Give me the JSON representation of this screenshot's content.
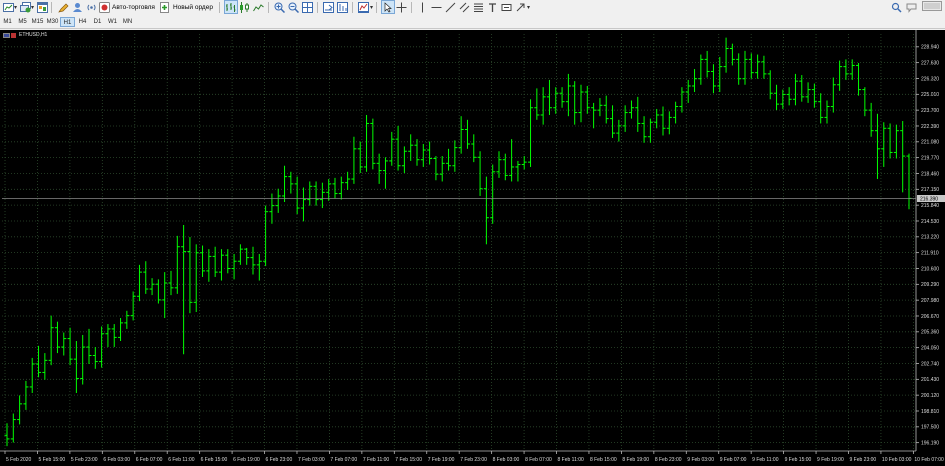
{
  "toolbar": {
    "autotrading_label": "Авто-торговля",
    "new_order_label": "Новый ордер"
  },
  "timeframes": [
    {
      "label": "M1",
      "active": false
    },
    {
      "label": "M5",
      "active": false
    },
    {
      "label": "M15",
      "active": false
    },
    {
      "label": "M30",
      "active": false
    },
    {
      "label": "H1",
      "active": true
    },
    {
      "label": "H4",
      "active": false
    },
    {
      "label": "D1",
      "active": false
    },
    {
      "label": "W1",
      "active": false
    },
    {
      "label": "MN",
      "active": false
    }
  ],
  "chart": {
    "symbol_label": "ETHUSD,H1",
    "current_price": "216.390",
    "price_ticks": [
      "228.940",
      "227.630",
      "226.320",
      "225.010",
      "223.700",
      "222.390",
      "221.080",
      "219.770",
      "218.460",
      "217.150",
      "215.840",
      "214.530",
      "213.220",
      "211.910",
      "210.600",
      "209.290",
      "207.980",
      "206.670",
      "205.360",
      "204.050",
      "202.740",
      "201.430",
      "200.120",
      "198.810",
      "197.500",
      "196.190"
    ],
    "time_ticks": [
      "5 Feb 2020",
      "5 Feb 15:00",
      "5 Feb 23:00",
      "6 Feb 03:00",
      "6 Feb 07:00",
      "6 Feb 11:00",
      "6 Feb 15:00",
      "6 Feb 19:00",
      "6 Feb 23:00",
      "7 Feb 03:00",
      "7 Feb 07:00",
      "7 Feb 11:00",
      "7 Feb 15:00",
      "7 Feb 19:00",
      "7 Feb 23:00",
      "8 Feb 03:00",
      "8 Feb 07:00",
      "8 Feb 11:00",
      "8 Feb 15:00",
      "8 Feb 19:00",
      "8 Feb 23:00",
      "9 Feb 03:00",
      "9 Feb 07:00",
      "9 Feb 11:00",
      "9 Feb 15:00",
      "9 Feb 19:00",
      "9 Feb 23:00",
      "10 Feb 03:00",
      "10 Feb 07:00"
    ],
    "bar_color": "#00ff00",
    "grid_color": "#2e4a2e"
  },
  "chart_data": {
    "type": "ohlc",
    "price_range": [
      195.5,
      230.0
    ],
    "series": [
      {
        "values": [
          [
            196.8,
            197.8,
            195.9,
            196.5
          ],
          [
            196.5,
            198.6,
            196.2,
            198.1
          ],
          [
            198.1,
            200.1,
            197.7,
            199.4
          ],
          [
            199.4,
            201.3,
            198.9,
            200.8
          ],
          [
            200.8,
            203.2,
            200.3,
            202.7
          ],
          [
            202.7,
            204.2,
            201.6,
            202.0
          ],
          [
            202.0,
            203.6,
            201.4,
            203.0
          ],
          [
            203.0,
            206.7,
            202.6,
            205.7
          ],
          [
            205.7,
            206.2,
            203.6,
            204.1
          ],
          [
            204.1,
            205.3,
            203.4,
            204.8
          ],
          [
            204.8,
            205.7,
            202.6,
            203.1
          ],
          [
            203.1,
            204.6,
            200.3,
            201.5
          ],
          [
            201.5,
            205.1,
            201.0,
            204.1
          ],
          [
            204.1,
            205.6,
            202.7,
            203.4
          ],
          [
            203.4,
            204.1,
            202.3,
            202.9
          ],
          [
            202.9,
            205.8,
            202.4,
            205.2
          ],
          [
            205.2,
            206.0,
            204.1,
            205.6
          ],
          [
            205.6,
            206.0,
            204.1,
            204.9
          ],
          [
            204.9,
            206.5,
            204.6,
            206.1
          ],
          [
            206.1,
            207.1,
            205.6,
            206.7
          ],
          [
            206.7,
            208.7,
            206.3,
            208.3
          ],
          [
            208.3,
            210.9,
            207.9,
            210.3
          ],
          [
            210.3,
            211.2,
            208.5,
            208.9
          ],
          [
            208.9,
            209.8,
            208.4,
            209.3
          ],
          [
            209.3,
            209.7,
            207.7,
            208.0
          ],
          [
            208.0,
            210.3,
            206.5,
            209.4
          ],
          [
            209.4,
            210.4,
            208.4,
            209.0
          ],
          [
            209.0,
            213.3,
            208.5,
            212.4
          ],
          [
            212.4,
            214.2,
            203.5,
            212.0
          ],
          [
            212.0,
            213.2,
            206.9,
            207.8
          ],
          [
            207.8,
            212.6,
            207.0,
            211.9
          ],
          [
            211.9,
            212.5,
            209.9,
            210.4
          ],
          [
            210.4,
            212.2,
            209.5,
            211.6
          ],
          [
            211.6,
            212.4,
            209.9,
            210.3
          ],
          [
            210.3,
            212.2,
            209.6,
            211.7
          ],
          [
            211.7,
            212.2,
            210.2,
            210.6
          ],
          [
            210.6,
            211.8,
            209.7,
            211.2
          ],
          [
            211.2,
            212.6,
            210.9,
            212.2
          ],
          [
            212.2,
            212.3,
            210.9,
            211.5
          ],
          [
            211.5,
            212.4,
            210.1,
            210.9
          ],
          [
            210.9,
            211.8,
            209.6,
            211.2
          ],
          [
            211.2,
            215.8,
            210.8,
            215.3
          ],
          [
            215.3,
            216.8,
            214.3,
            215.8
          ],
          [
            215.8,
            217.2,
            215.2,
            216.6
          ],
          [
            216.6,
            219.1,
            216.1,
            218.2
          ],
          [
            218.2,
            218.6,
            216.8,
            217.6
          ],
          [
            217.6,
            218.2,
            215.1,
            215.6
          ],
          [
            215.6,
            217.3,
            214.5,
            216.3
          ],
          [
            216.3,
            217.8,
            215.8,
            217.4
          ],
          [
            217.4,
            217.8,
            215.8,
            216.3
          ],
          [
            216.3,
            217.7,
            215.6,
            216.9
          ],
          [
            216.9,
            218.0,
            216.2,
            217.6
          ],
          [
            217.6,
            218.1,
            216.4,
            216.8
          ],
          [
            216.8,
            218.2,
            216.3,
            217.7
          ],
          [
            217.7,
            218.6,
            217.1,
            218.0
          ],
          [
            218.0,
            221.5,
            217.6,
            220.5
          ],
          [
            220.5,
            221.1,
            218.5,
            219.0
          ],
          [
            219.0,
            223.3,
            218.6,
            222.6
          ],
          [
            222.6,
            223.0,
            218.8,
            219.3
          ],
          [
            219.3,
            220.1,
            217.6,
            218.7
          ],
          [
            218.7,
            219.8,
            217.2,
            219.5
          ],
          [
            219.5,
            221.9,
            219.1,
            221.3
          ],
          [
            221.3,
            222.4,
            218.7,
            219.1
          ],
          [
            219.1,
            220.7,
            218.5,
            220.3
          ],
          [
            220.3,
            221.7,
            219.5,
            220.8
          ],
          [
            220.8,
            221.3,
            219.1,
            219.6
          ],
          [
            219.6,
            220.9,
            219.0,
            220.4
          ],
          [
            220.4,
            221.1,
            219.2,
            219.7
          ],
          [
            219.7,
            219.9,
            217.9,
            218.4
          ],
          [
            218.4,
            219.9,
            217.8,
            219.3
          ],
          [
            219.3,
            220.5,
            218.7,
            219.1
          ],
          [
            219.1,
            221.2,
            218.6,
            220.6
          ],
          [
            220.6,
            223.2,
            220.1,
            222.1
          ],
          [
            222.1,
            222.9,
            220.5,
            220.9
          ],
          [
            220.9,
            221.7,
            219.4,
            219.8
          ],
          [
            219.8,
            220.3,
            216.6,
            217.2
          ],
          [
            217.2,
            218.2,
            212.6,
            214.8
          ],
          [
            214.8,
            219.2,
            214.3,
            218.6
          ],
          [
            218.6,
            220.3,
            218.1,
            219.6
          ],
          [
            219.6,
            220.1,
            217.9,
            218.3
          ],
          [
            218.3,
            221.3,
            217.8,
            219.0
          ],
          [
            219.0,
            219.5,
            217.8,
            219.2
          ],
          [
            219.2,
            219.9,
            218.8,
            219.4
          ],
          [
            219.4,
            224.6,
            219.0,
            223.9
          ],
          [
            223.9,
            225.5,
            222.9,
            223.3
          ],
          [
            223.3,
            225.6,
            222.5,
            224.8
          ],
          [
            224.8,
            226.2,
            223.3,
            223.9
          ],
          [
            223.9,
            225.6,
            223.4,
            225.1
          ],
          [
            225.1,
            225.6,
            223.9,
            224.4
          ],
          [
            224.4,
            226.7,
            223.2,
            225.7
          ],
          [
            225.7,
            226.1,
            222.5,
            223.5
          ],
          [
            223.5,
            225.8,
            222.7,
            225.2
          ],
          [
            225.2,
            225.7,
            223.4,
            223.9
          ],
          [
            223.9,
            224.3,
            222.2,
            223.7
          ],
          [
            223.7,
            224.7,
            223.2,
            224.1
          ],
          [
            224.1,
            224.9,
            222.6,
            223.0
          ],
          [
            223.0,
            224.1,
            221.4,
            221.8
          ],
          [
            221.8,
            222.9,
            221.1,
            222.4
          ],
          [
            222.4,
            224.1,
            221.9,
            223.5
          ],
          [
            223.5,
            224.5,
            223.0,
            223.9
          ],
          [
            223.9,
            224.8,
            221.9,
            222.6
          ],
          [
            222.6,
            223.2,
            221.0,
            221.5
          ],
          [
            221.5,
            223.0,
            221.0,
            222.7
          ],
          [
            222.7,
            223.8,
            222.2,
            223.3
          ],
          [
            223.3,
            224.0,
            221.6,
            222.2
          ],
          [
            222.2,
            223.6,
            221.7,
            223.1
          ],
          [
            223.1,
            224.4,
            222.6,
            224.0
          ],
          [
            224.0,
            225.6,
            223.5,
            225.2
          ],
          [
            225.2,
            226.2,
            224.3,
            225.7
          ],
          [
            225.7,
            227.1,
            225.2,
            226.3
          ],
          [
            226.3,
            228.3,
            225.8,
            227.9
          ],
          [
            227.9,
            228.6,
            226.4,
            226.9
          ],
          [
            226.9,
            227.5,
            225.1,
            225.7
          ],
          [
            225.7,
            228.1,
            225.2,
            227.3
          ],
          [
            227.3,
            229.7,
            226.8,
            228.8
          ],
          [
            228.8,
            229.2,
            227.4,
            227.9
          ],
          [
            227.9,
            228.4,
            225.8,
            226.3
          ],
          [
            226.3,
            228.6,
            225.8,
            227.9
          ],
          [
            227.9,
            228.4,
            226.3,
            226.8
          ],
          [
            226.8,
            228.3,
            226.3,
            227.7
          ],
          [
            227.7,
            228.2,
            226.3,
            226.7
          ],
          [
            226.7,
            227.0,
            224.6,
            225.1
          ],
          [
            225.1,
            225.8,
            223.7,
            224.2
          ],
          [
            224.2,
            225.4,
            223.8,
            225.0
          ],
          [
            225.0,
            225.6,
            224.1,
            224.6
          ],
          [
            224.6,
            226.7,
            224.1,
            226.1
          ],
          [
            226.1,
            226.6,
            224.4,
            224.8
          ],
          [
            224.8,
            226.0,
            224.3,
            225.4
          ],
          [
            225.4,
            225.9,
            223.9,
            224.4
          ],
          [
            224.4,
            225.1,
            222.6,
            223.1
          ],
          [
            223.1,
            224.5,
            222.6,
            224.0
          ],
          [
            224.0,
            226.4,
            223.5,
            225.8
          ],
          [
            225.8,
            227.8,
            225.3,
            227.3
          ],
          [
            227.3,
            227.9,
            226.2,
            226.7
          ],
          [
            226.7,
            227.9,
            226.2,
            227.4
          ],
          [
            227.4,
            227.6,
            224.9,
            225.4
          ],
          [
            225.4,
            225.6,
            223.2,
            223.7
          ],
          [
            223.7,
            224.3,
            221.5,
            222.0
          ],
          [
            222.0,
            223.4,
            218.0,
            220.5
          ],
          [
            220.5,
            222.7,
            219.0,
            222.2
          ],
          [
            222.2,
            222.6,
            219.7,
            220.2
          ],
          [
            220.2,
            222.5,
            219.7,
            222.0
          ],
          [
            222.0,
            222.8,
            216.9,
            219.9
          ],
          [
            219.9,
            220.1,
            215.5,
            216.4
          ]
        ]
      }
    ]
  }
}
